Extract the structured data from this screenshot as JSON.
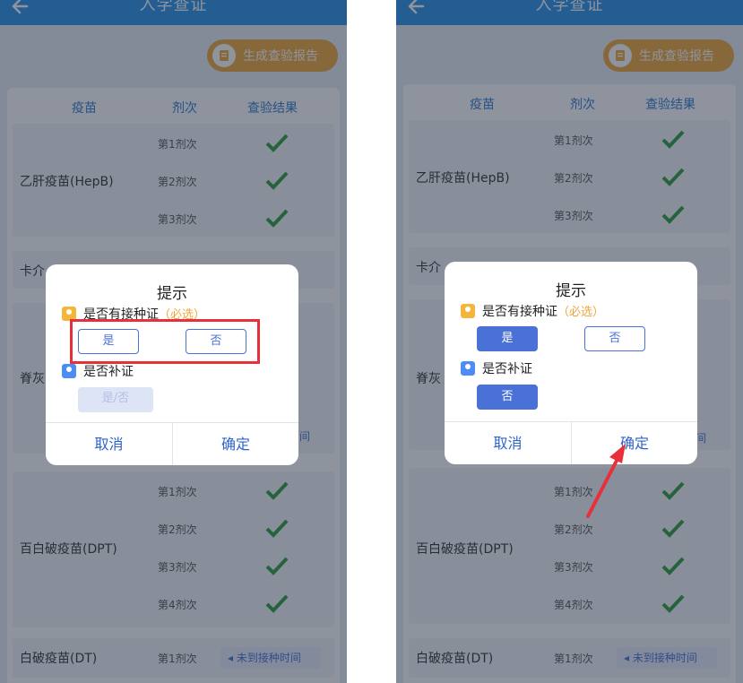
{
  "app": {
    "title": "入学查证",
    "report_button": "生成查验报告"
  },
  "table": {
    "headers": {
      "vaccine": "疫苗",
      "dose": "剂次",
      "result": "查验结果"
    },
    "hepb": {
      "name": "乙肝疫苗(HepB)",
      "doses": [
        "第1剂次",
        "第2剂次",
        "第3剂次"
      ]
    },
    "bcg_partial": "卡介",
    "polio_partial": "脊灰",
    "dpt": {
      "name": "百白破疫苗(DPT)",
      "doses": [
        "第1剂次",
        "第2剂次",
        "第3剂次",
        "第4剂次"
      ]
    },
    "dt": {
      "name": "白破疫苗(DT)",
      "dose": "第1剂次",
      "status": "未到接种时间"
    },
    "peek_text": "间"
  },
  "dialog": {
    "title": "提示",
    "q1": "是否有接种证",
    "q1_required": "（必选）",
    "q2": "是否补证",
    "yes": "是",
    "no": "否",
    "yes_no_placeholder": "是/否",
    "cancel": "取消",
    "confirm": "确定"
  },
  "colors": {
    "header_blue": "#2a93e8",
    "accent_blue": "#4a72d6",
    "check_green": "#2e9e3e",
    "orange": "#f0a93b",
    "annotation_red": "#e8303a"
  },
  "icons": [
    "back-arrow-icon",
    "document-icon",
    "checkmark-icon",
    "question-badge-icon",
    "triangle-left-icon"
  ]
}
